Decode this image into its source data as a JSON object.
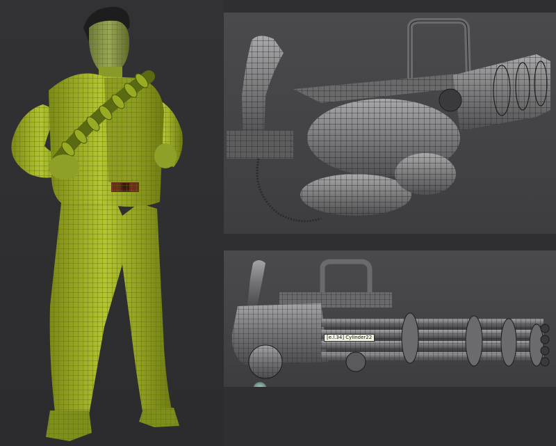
{
  "viewport_bottom": {
    "tooltip_label": "[e.l.34] Cylinder22"
  },
  "colors": {
    "background": "#2f2f31",
    "viewport": "#464648",
    "figure_green": "#9fb02a",
    "wireframe": "#1c1c1c",
    "model_gray": "#8a8a8c"
  },
  "icons": {
    "viewport_gizmo": "axis-gizmo-icon"
  }
}
